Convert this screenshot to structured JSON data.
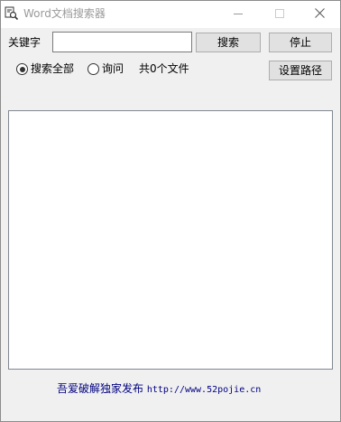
{
  "window": {
    "title": "Word文档搜索器"
  },
  "search": {
    "keyword_label": "关键字",
    "keyword_value": "",
    "search_button": "搜索",
    "stop_button": "停止"
  },
  "options": {
    "radio_all_label": "搜索全部",
    "radio_all_checked": true,
    "radio_query_label": "询问",
    "radio_query_checked": false,
    "file_count_text": "共0个文件",
    "set_path_button": "设置路径"
  },
  "footer": {
    "text": "吾爱破解独家发布",
    "url": "http://www.52pojie.cn",
    "color": "#000080"
  },
  "icons": [
    "app-search-icon",
    "minimize-icon",
    "maximize-icon",
    "close-icon"
  ]
}
